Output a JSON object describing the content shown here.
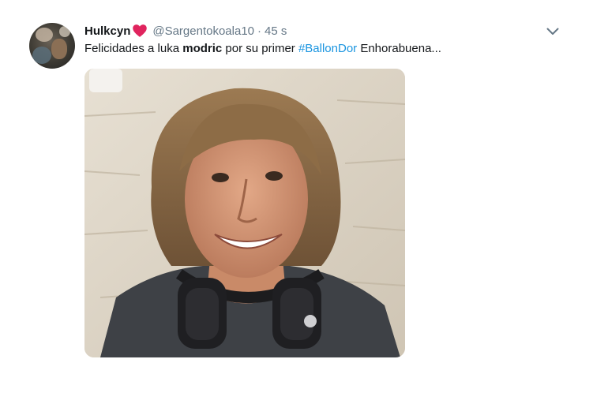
{
  "tweet": {
    "display_name": "Hulkcyn",
    "handle": "@Sargentokoala10",
    "separator": "·",
    "time": "45 s",
    "text_before": "Felicidades a luka ",
    "text_bold": "modric",
    "text_middle": " por su primer ",
    "hashtag": "#BallonDor",
    "text_after": " Enhorabuena..."
  },
  "icons": {
    "heart": "red-heart-emoji",
    "caret": "chevron-down-icon"
  },
  "colors": {
    "link": "#1b95e0",
    "secondary_text": "#657786",
    "heart": "#e0245e"
  }
}
